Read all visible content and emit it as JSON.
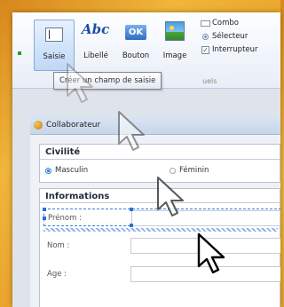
{
  "ribbon": {
    "tools": [
      {
        "label": "Saisie",
        "icon": "text-field-icon"
      },
      {
        "label": "Libellé",
        "icon_text": "Abc"
      },
      {
        "label": "Bouton",
        "icon_text": "OK"
      },
      {
        "label": "Image",
        "icon": "image-icon"
      }
    ],
    "list": [
      {
        "label": "Combo"
      },
      {
        "label": "Sélecteur"
      },
      {
        "label": "Interrupteur"
      }
    ],
    "group_label": "uels"
  },
  "tooltip": "Créer un champ de saisie",
  "window": {
    "title": "Collaborateur"
  },
  "civilite": {
    "title": "Civilité",
    "options": [
      {
        "label": "Masculin",
        "selected": true
      },
      {
        "label": "Féminin",
        "selected": false
      }
    ]
  },
  "informations": {
    "title": "Informations",
    "fields": [
      {
        "label": "Prénom :"
      },
      {
        "label": "Nom :"
      },
      {
        "label": "Age :"
      }
    ]
  },
  "colors": {
    "accent": "#2f7fd6",
    "background": "#e79f27"
  }
}
